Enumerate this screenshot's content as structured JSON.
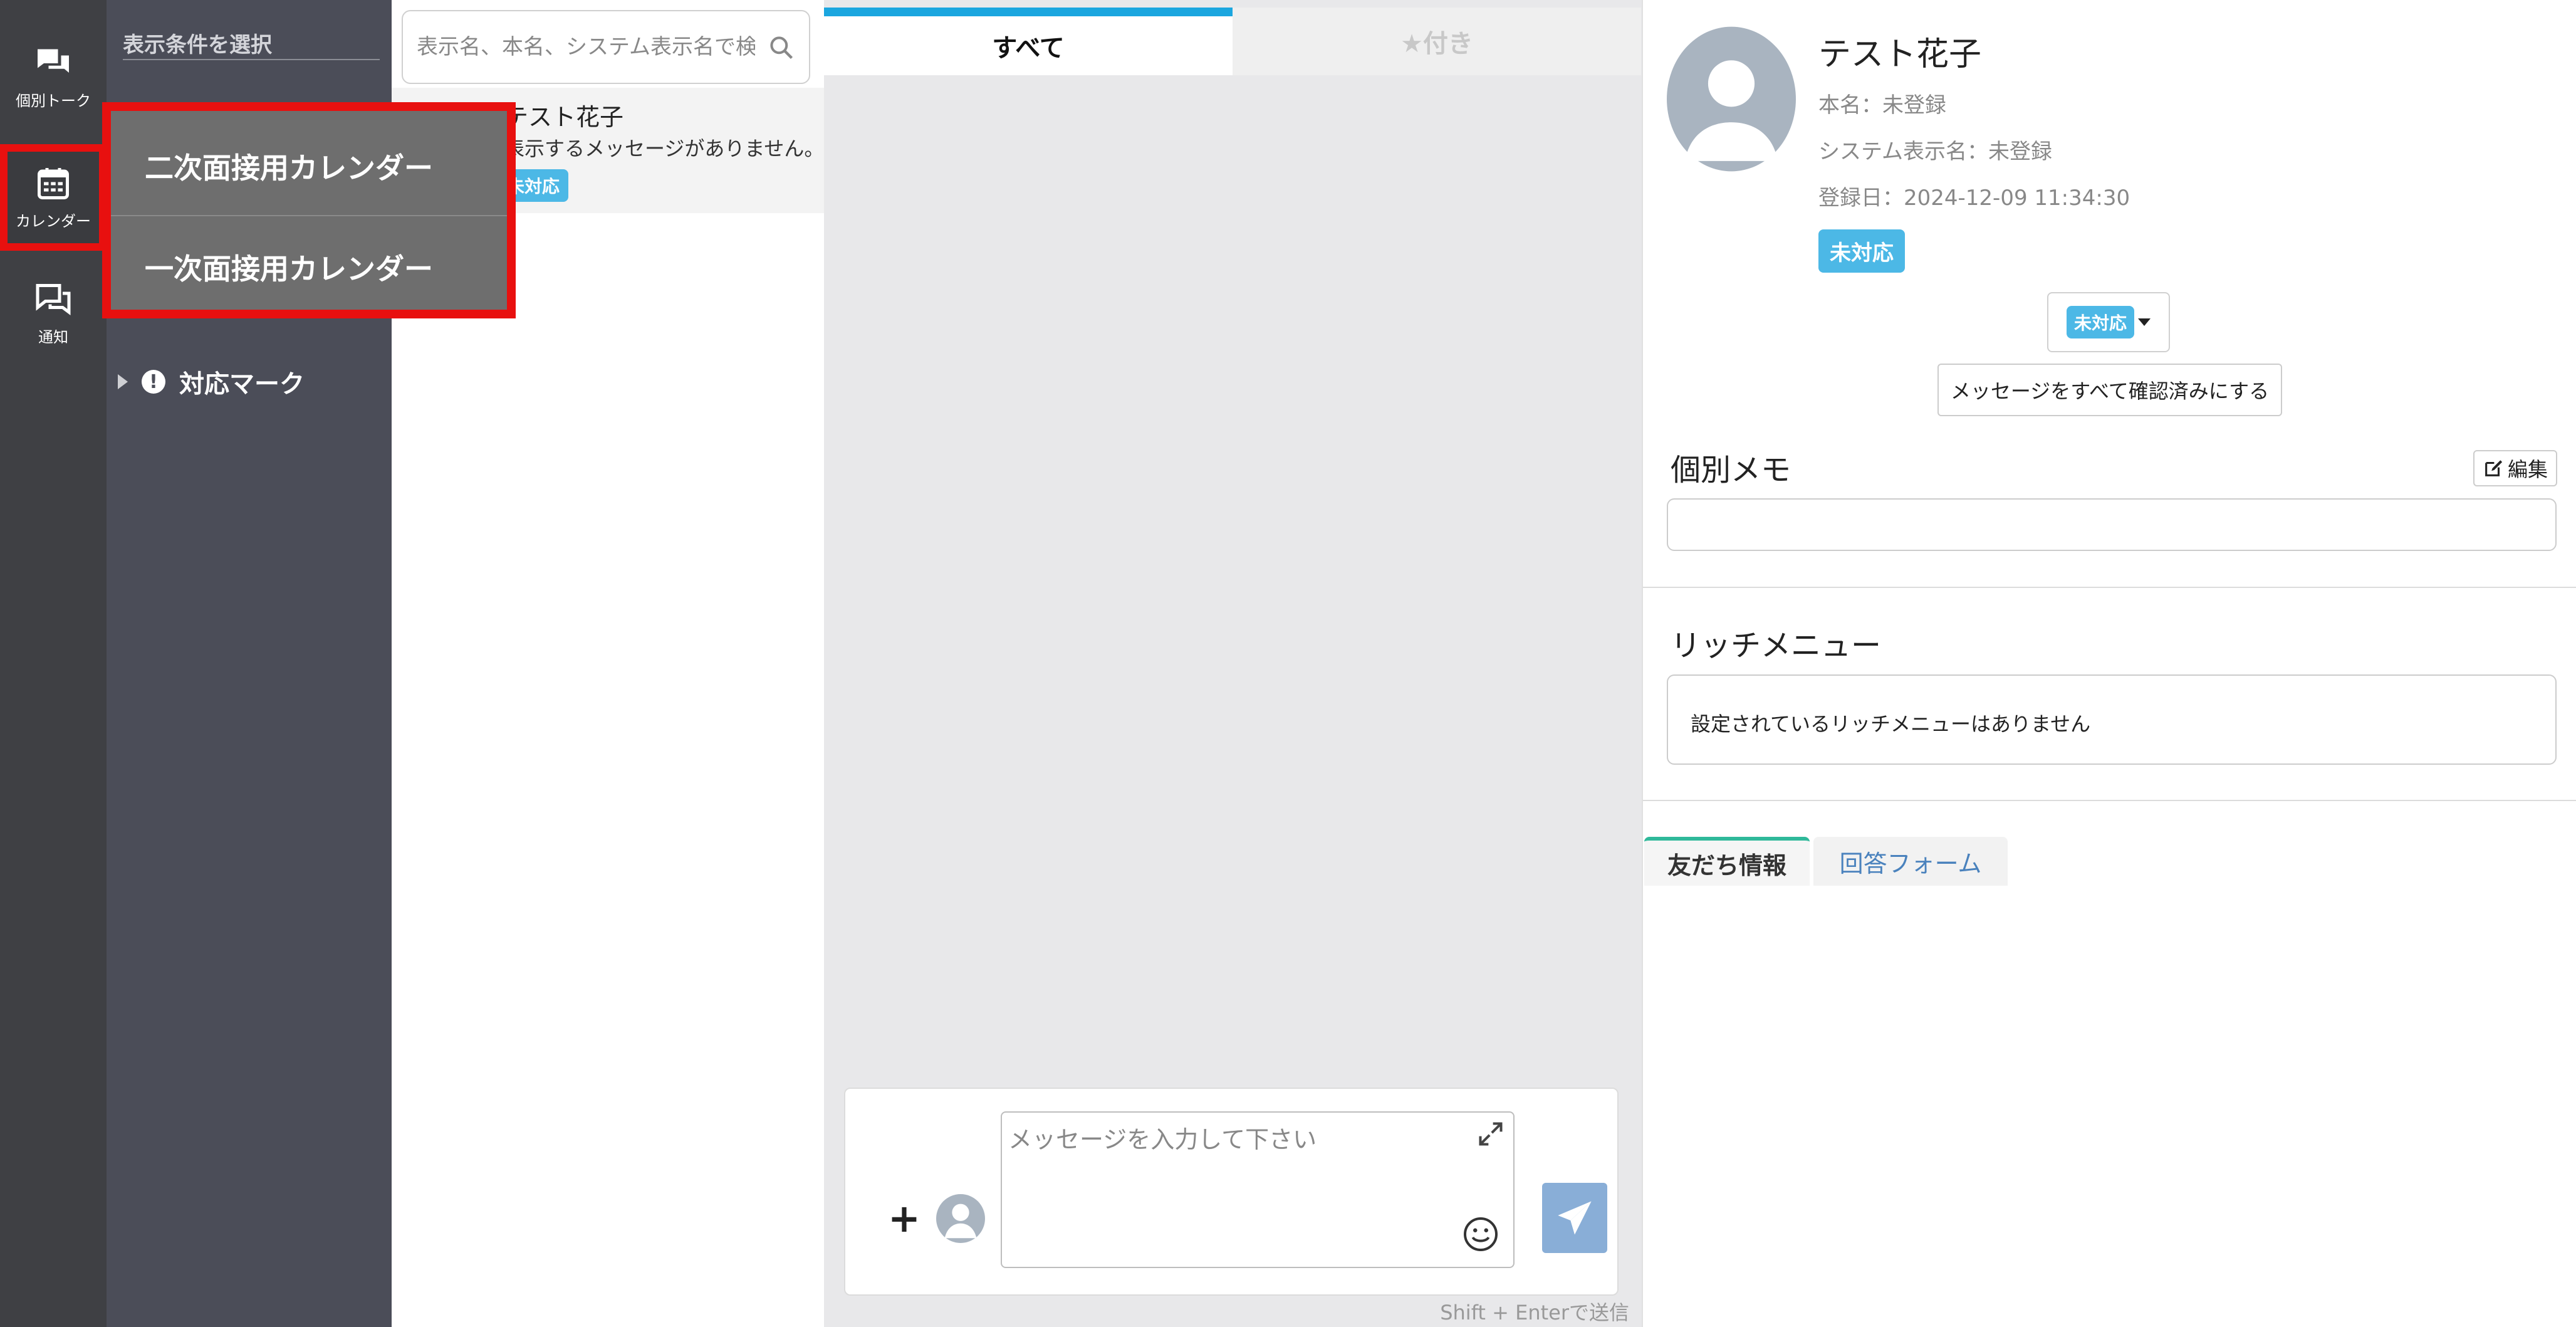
{
  "nav": {
    "items": [
      {
        "label": "個別トーク",
        "icon": "chat-bubbles-icon"
      },
      {
        "label": "カレンダー",
        "icon": "calendar-icon"
      },
      {
        "label": "通知",
        "icon": "notification-icon"
      }
    ]
  },
  "filter": {
    "title": "表示条件を選択",
    "items": [
      {
        "label": "対応マーク"
      }
    ]
  },
  "calendar_menu": {
    "items": [
      {
        "label": "二次面接用カレンダー"
      },
      {
        "label": "一次面接用カレンダー"
      }
    ]
  },
  "contacts": {
    "search_placeholder": "表示名、本名、システム表示名で検索",
    "list": [
      {
        "name": "テスト花子",
        "preview": "表示するメッセージがありません。",
        "status": "未対応"
      }
    ]
  },
  "chat": {
    "tabs": [
      {
        "label": "すべて"
      },
      {
        "label": "★付き"
      }
    ],
    "input_placeholder": "メッセージを入力して下さい",
    "send_hint": "Shift + Enterで送信"
  },
  "profile": {
    "name": "テスト花子",
    "real_name": "本名：未登録",
    "system_name": "システム表示名：未登録",
    "registered": "登録日：2024-12-09 11:34:30",
    "status": "未対応",
    "status_dropdown": "未対応",
    "confirm_all_label": "メッセージをすべて確認済みにする",
    "memo_title": "個別メモ",
    "edit_label": "編集",
    "rich_menu_title": "リッチメニュー",
    "rich_menu_empty": "設定されているリッチメニューはありません",
    "tabs": [
      {
        "label": "友だち情報"
      },
      {
        "label": "回答フォーム"
      }
    ]
  },
  "colors": {
    "rail": "#3f4044",
    "filter_panel": "#4b4d58",
    "highlight": "#e8100f",
    "badge": "#4cb8e6",
    "tab_active": "#1ba6df",
    "send_button": "#89aed7",
    "friend_tab_accent": "#2fb99a",
    "link": "#4a82bd"
  }
}
